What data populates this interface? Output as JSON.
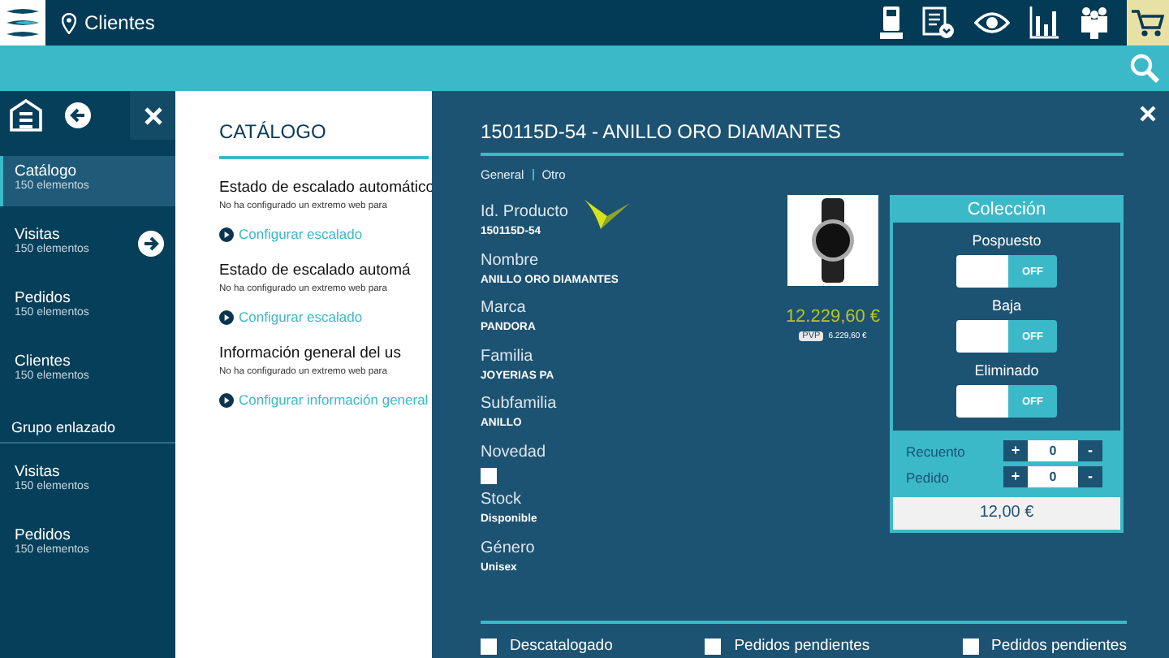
{
  "topbar": {
    "location": "Clientes"
  },
  "sidebar": {
    "items": [
      {
        "title": "Catálogo",
        "subtitle": "150 elementos",
        "selected": true,
        "arrow": false
      },
      {
        "title": "Visitas",
        "subtitle": "150 elementos",
        "selected": false,
        "arrow": true
      },
      {
        "title": "Pedidos",
        "subtitle": "150 elementos",
        "selected": false,
        "arrow": false
      },
      {
        "title": "Clientes",
        "subtitle": "150 elementos",
        "selected": false,
        "arrow": false
      }
    ],
    "group_label": "Grupo enlazado",
    "group_items": [
      {
        "title": "Visitas",
        "subtitle": "150 elementos",
        "selected": false,
        "arrow": false
      },
      {
        "title": "Pedidos",
        "subtitle": "150 elementos",
        "selected": false,
        "arrow": false
      }
    ]
  },
  "content": {
    "title": "CATÁLOGO",
    "sections": [
      {
        "heading": "Estado de escalado automático",
        "text": "No ha configurado un extremo web para",
        "link": "Configurar escalado"
      },
      {
        "heading": "Estado de escalado automá",
        "text": "No ha configurado un extremo web para",
        "link": "Configurar escalado"
      },
      {
        "heading": "Información general del us",
        "text": "No ha configurado un extremo web para",
        "link": "Configurar información general"
      }
    ]
  },
  "detail": {
    "title": "150115D-54 - ANILLO ORO DIAMANTES",
    "tabs": [
      "General",
      "Otro"
    ],
    "fields": [
      {
        "kind": "text",
        "label": "Id. Producto",
        "value": "150115D-54"
      },
      {
        "kind": "text",
        "label": "Nombre",
        "value": "ANILLO ORO DIAMANTES"
      },
      {
        "kind": "text",
        "label": "Marca",
        "value": "PANDORA"
      },
      {
        "kind": "text",
        "label": "Familia",
        "value": "JOYERIAS PA"
      },
      {
        "kind": "text",
        "label": "Subfamilia",
        "value": "ANILLO"
      },
      {
        "kind": "checkbox",
        "label": "Novedad",
        "checked": false
      },
      {
        "kind": "text",
        "label": "Stock",
        "value": "Disponible"
      },
      {
        "kind": "text",
        "label": "Género",
        "value": "Unisex"
      }
    ],
    "price": "12.229,60 €",
    "pvp_badge": "PVP",
    "pvp": "6.229,60 €",
    "collection": {
      "title": "Colección",
      "toggles": [
        {
          "label": "Pospuesto",
          "on": false,
          "text": "OFF"
        },
        {
          "label": "Baja",
          "on": false,
          "text": "OFF"
        },
        {
          "label": "Eliminado",
          "on": false,
          "text": "OFF"
        }
      ],
      "counters": [
        {
          "label": "Recuento",
          "plus": "+",
          "value": "0",
          "minus": "-"
        },
        {
          "label": "Pedido",
          "plus": "+",
          "value": "0",
          "minus": "-"
        }
      ],
      "total": "12,00 €"
    },
    "footer_checks": [
      {
        "label": "Descatalogado",
        "checked": false
      },
      {
        "label": "Pedidos pendientes",
        "checked": false
      },
      {
        "label": "Pedidos pendientes",
        "checked": false
      }
    ]
  }
}
